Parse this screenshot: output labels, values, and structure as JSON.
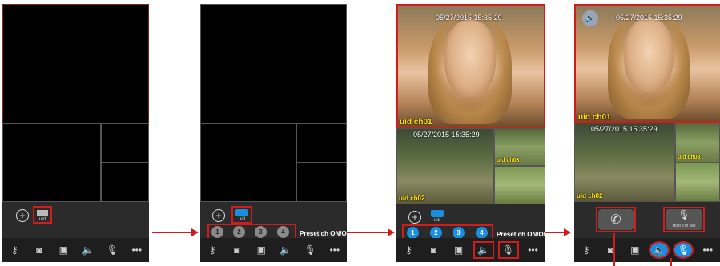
{
  "panels": {
    "p3": {
      "main": {
        "timestamp": "05/27/2015 15:35:29",
        "uid": "uid ch01"
      },
      "sub": {
        "timestamp": "05/27/2015 15:35:29",
        "uid": "uid ch02"
      },
      "side_top": {
        "uid": "uid ch03"
      }
    },
    "p4": {
      "main": {
        "timestamp": "05/27/2015 15:35:29",
        "uid": "uid ch01"
      },
      "sub": {
        "timestamp": "05/27/2015 15:35:29",
        "uid": "uid ch02"
      },
      "side_top": {
        "uid": "uid ch03"
      },
      "hold_label": "Hold it to talk"
    }
  },
  "preset_buttons": [
    "1",
    "2",
    "3",
    "4"
  ],
  "preset_label": "Preset ch ON/OFF",
  "tab_label": "uid",
  "icons": [
    "plus-circle-icon",
    "camera-icon",
    "key-icon",
    "snapshot-icon",
    "record-icon",
    "speaker-icon",
    "microphone-icon",
    "more-icon",
    "phone-icon"
  ],
  "colors": {
    "highlight": "#d11c1c",
    "active": "#1a8fe0",
    "uid_text": "#ffe400"
  }
}
